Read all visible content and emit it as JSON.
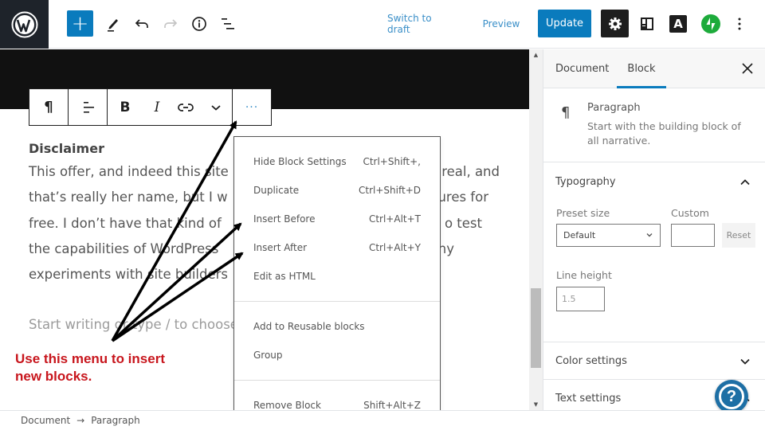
{
  "header": {
    "logo": "wordpress-logo",
    "add_block_label": "+",
    "switch_to_draft_label": "Switch to draft",
    "preview_label": "Preview",
    "update_label": "Update",
    "astra_label": "A",
    "icons": [
      "wordpress-logo",
      "plus-icon",
      "pencil-icon",
      "undo-icon",
      "redo-icon",
      "info-icon",
      "list-view-icon",
      "gear-icon",
      "block-layout-icon",
      "astra-icon",
      "jetpack-icon",
      "kebab-menu-icon"
    ]
  },
  "block_toolbar": {
    "paragraph_icon": "¶",
    "bold_label": "B",
    "italic_label": "I",
    "more_label": "···"
  },
  "editor": {
    "heading": "Disclaimer",
    "paragraph": "This offer, and indeed this site, isn't real. Lisa is real, and that's really her name, but I won't give away any fixtures for free. I don't have that kind of money. This site was built to test the capabilities of WordPress and Gutenberg, and it's where my experiments with site builders live.",
    "paragraph_lines": [
      "This offer, and indeed this site",
      "that’s really her name, but I w",
      "free. I don’t have that kind of",
      "the capabilities of WordPress",
      "experiments with site builders"
    ],
    "paragraph_line_ends": [
      "real, and",
      "ures for",
      "o test",
      "ny",
      ""
    ],
    "placeholder": "Start writing or type / to choose a block"
  },
  "annotation": {
    "text_line1": "Use this menu to insert",
    "text_line2": "new blocks.",
    "color": "#c8161d"
  },
  "more_menu": {
    "groups": [
      [
        {
          "label": "Hide Block Settings",
          "shortcut": "Ctrl+Shift+,"
        },
        {
          "label": "Duplicate",
          "shortcut": "Ctrl+Shift+D"
        },
        {
          "label": "Insert Before",
          "shortcut": "Ctrl+Alt+T"
        },
        {
          "label": "Insert After",
          "shortcut": "Ctrl+Alt+Y"
        },
        {
          "label": "Edit as HTML",
          "shortcut": ""
        }
      ],
      [
        {
          "label": "Add to Reusable blocks",
          "shortcut": ""
        },
        {
          "label": "Group",
          "shortcut": ""
        }
      ],
      [
        {
          "label": "Remove Block",
          "shortcut": "Shift+Alt+Z"
        }
      ]
    ]
  },
  "sidebar": {
    "tabs": [
      {
        "label": "Document",
        "active": false
      },
      {
        "label": "Block",
        "active": true
      }
    ],
    "block_card": {
      "icon": "¶",
      "title": "Paragraph",
      "description": "Start with the building block of all narrative."
    },
    "typography": {
      "title": "Typography",
      "preset_size_label": "Preset size",
      "preset_size_value": "Default",
      "custom_label": "Custom",
      "custom_value": "",
      "reset_label": "Reset",
      "line_height_label": "Line height",
      "line_height_placeholder": "1.5"
    },
    "color_settings": {
      "title": "Color settings"
    },
    "text_settings": {
      "title": "Text settings"
    }
  },
  "help_button": {
    "label": "?"
  },
  "footer": {
    "breadcrumb": [
      {
        "label": "Document"
      },
      {
        "label": "Paragraph"
      }
    ],
    "separator": "→"
  },
  "colors": {
    "accent": "#0a7bbd",
    "header_dark": "#1e232a",
    "jetpack_green": "#1dab3b",
    "annotation_red": "#c8161d"
  }
}
